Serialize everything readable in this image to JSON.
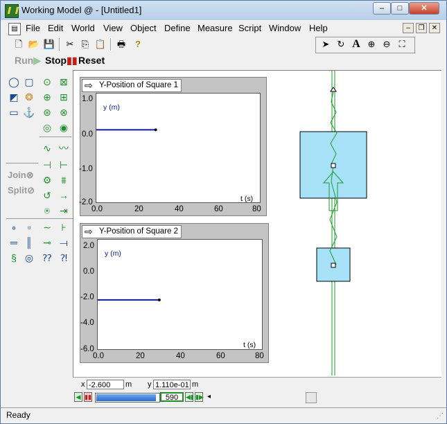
{
  "window": {
    "title": "Working Model @ - [Untitled1]"
  },
  "caption": {
    "minimize": "–",
    "maximize": "□",
    "close": "✕"
  },
  "menu": [
    "File",
    "Edit",
    "World",
    "View",
    "Object",
    "Define",
    "Measure",
    "Script",
    "Window",
    "Help"
  ],
  "mdi": {
    "minimize": "–",
    "restore": "❐",
    "close": "✕"
  },
  "runbar": {
    "run": "Run",
    "stop": "Stop",
    "reset": "Reset"
  },
  "palette": {
    "join": "Join",
    "split": "Split"
  },
  "meters": [
    {
      "title": "Y-Position of Square 1",
      "ylabel": "y (m)",
      "xlabel": "t (s)",
      "yticks": [
        "1.0",
        "0.0",
        "-1.0",
        "-2.0"
      ],
      "xticks": [
        "0.0",
        "20",
        "40",
        "60",
        "80"
      ]
    },
    {
      "title": "Y-Position of Square 2",
      "ylabel": "y (m)",
      "xlabel": "t (s)",
      "yticks": [
        "2.0",
        "0.0",
        "-2.0",
        "-4.0",
        "-6.0"
      ],
      "xticks": [
        "0.0",
        "20",
        "40",
        "60",
        "80"
      ]
    }
  ],
  "chart_data": [
    {
      "type": "line",
      "title": "Y-Position of Square 1",
      "xlabel": "t (s)",
      "ylabel": "y (m)",
      "xlim": [
        0,
        80
      ],
      "ylim": [
        -2,
        1
      ],
      "series": [
        {
          "x": [
            0,
            10,
            20,
            29
          ],
          "y": [
            0,
            0,
            0,
            0
          ]
        }
      ]
    },
    {
      "type": "line",
      "title": "Y-Position of Square 2",
      "xlabel": "t (s)",
      "ylabel": "y (m)",
      "xlim": [
        0,
        80
      ],
      "ylim": [
        -6,
        2
      ],
      "series": [
        {
          "x": [
            0,
            10,
            20,
            30
          ],
          "y": [
            -2.4,
            -2.4,
            -2.4,
            -2.4
          ]
        }
      ]
    }
  ],
  "coords": {
    "x_label": "x",
    "x_value": "-2.600",
    "x_unit": "m",
    "y_label": "y",
    "y_value": "1.110e-01",
    "y_unit": "m"
  },
  "tape": {
    "frame": "590",
    "progress": 0.95
  },
  "status": {
    "text": "Ready"
  },
  "colors": {
    "body": "#a6e1f7",
    "spring": "#1f9a2a",
    "trace": "#0a1a9a"
  }
}
